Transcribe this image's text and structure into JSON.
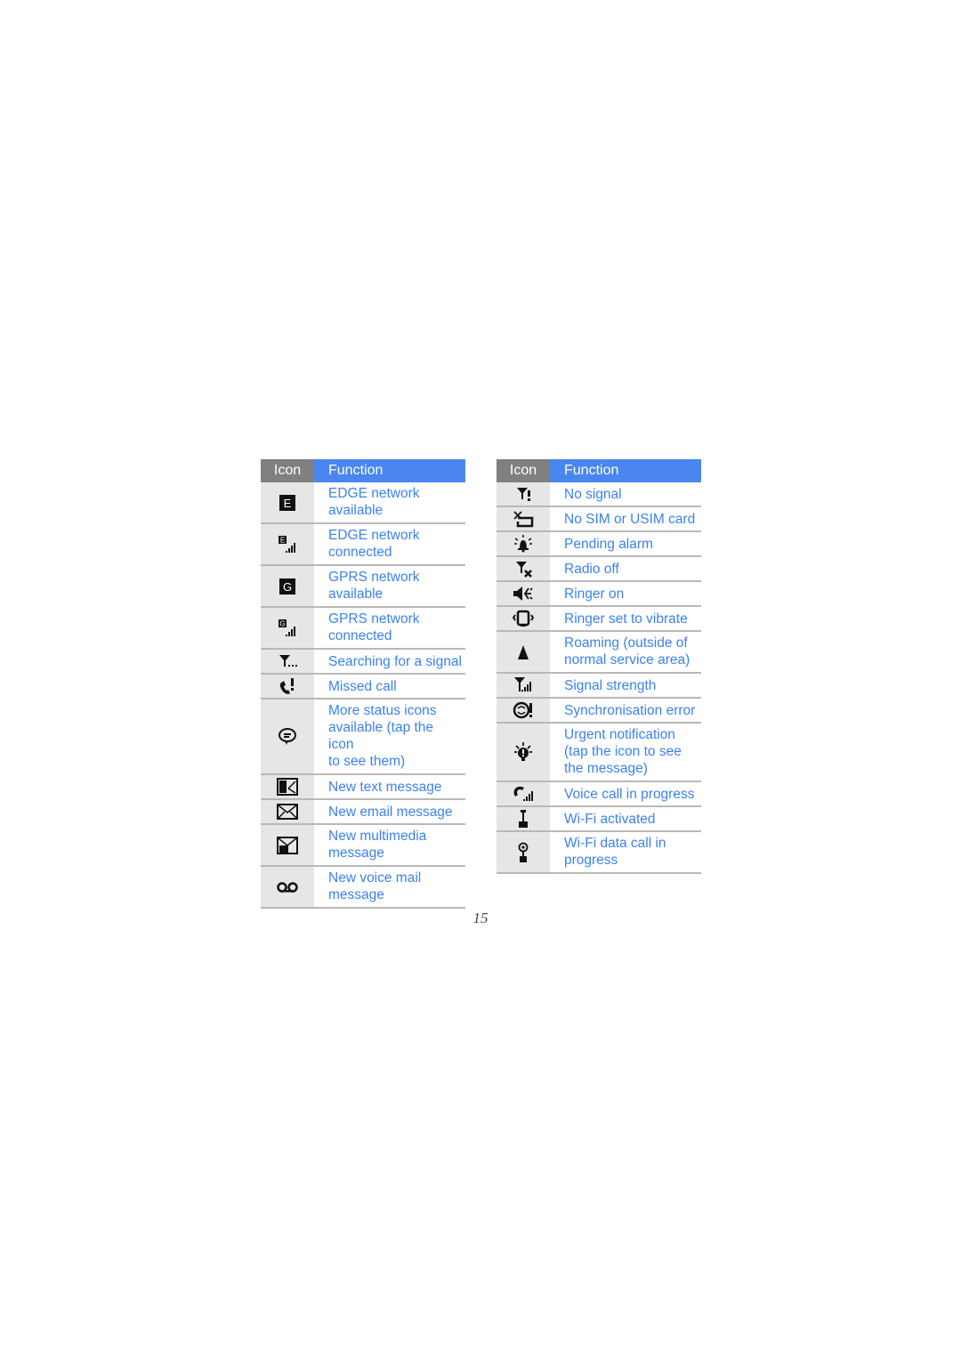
{
  "tables": [
    {
      "header": {
        "icon": "Icon",
        "function": "Function"
      },
      "rows": [
        {
          "icon": "edge-available-icon",
          "glyph": "E",
          "text": "EDGE network available",
          "lines": [
            "EDGE network",
            "available"
          ]
        },
        {
          "icon": "edge-connected-icon",
          "glyph": "E",
          "text": "EDGE network connected",
          "lines": [
            "EDGE network",
            "connected"
          ]
        },
        {
          "icon": "gprs-available-icon",
          "glyph": "G",
          "text": "GPRS network available",
          "lines": [
            "GPRS network",
            "available"
          ]
        },
        {
          "icon": "gprs-connected-icon",
          "glyph": "G",
          "text": "GPRS network connected",
          "lines": [
            "GPRS network",
            "connected"
          ]
        },
        {
          "icon": "searching-signal-icon",
          "text": "Searching for a signal",
          "lines": [
            "Searching for a signal"
          ]
        },
        {
          "icon": "missed-call-icon",
          "text": "Missed call",
          "lines": [
            "Missed call"
          ]
        },
        {
          "icon": "more-status-icon",
          "text": "More status icons available (tap the icon to see them)",
          "lines": [
            "More status icons",
            "available (tap the icon",
            "to see them)"
          ]
        },
        {
          "icon": "new-text-message-icon",
          "text": "New text message",
          "lines": [
            "New text message"
          ]
        },
        {
          "icon": "new-email-icon",
          "text": "New email message",
          "lines": [
            "New email message"
          ]
        },
        {
          "icon": "new-multimedia-message-icon",
          "text": "New multimedia message",
          "lines": [
            "New multimedia",
            "message"
          ]
        },
        {
          "icon": "voice-mail-icon",
          "text": "New voice mail message",
          "lines": [
            "New voice mail",
            "message"
          ]
        }
      ]
    },
    {
      "header": {
        "icon": "Icon",
        "function": "Function"
      },
      "rows": [
        {
          "icon": "no-signal-icon",
          "text": "No signal",
          "lines": [
            "No signal"
          ]
        },
        {
          "icon": "no-sim-icon",
          "text": "No SIM or USIM card",
          "lines": [
            "No SIM or USIM card"
          ]
        },
        {
          "icon": "pending-alarm-icon",
          "text": "Pending alarm",
          "lines": [
            "Pending alarm"
          ]
        },
        {
          "icon": "radio-off-icon",
          "text": "Radio off",
          "lines": [
            "Radio off"
          ]
        },
        {
          "icon": "ringer-on-icon",
          "text": "Ringer on",
          "lines": [
            "Ringer on"
          ]
        },
        {
          "icon": "vibrate-icon",
          "text": "Ringer set to vibrate",
          "lines": [
            "Ringer set to vibrate"
          ]
        },
        {
          "icon": "roaming-icon",
          "text": "Roaming (outside of normal service area)",
          "lines": [
            "Roaming (outside of",
            "normal service area)"
          ]
        },
        {
          "icon": "signal-strength-icon",
          "text": "Signal strength",
          "lines": [
            "Signal strength"
          ]
        },
        {
          "icon": "sync-error-icon",
          "text": "Synchronisation error",
          "lines": [
            "Synchronisation error"
          ]
        },
        {
          "icon": "urgent-notification-icon",
          "text": "Urgent notification (tap the icon to see the message)",
          "lines": [
            "Urgent notification",
            "(tap the icon to see",
            "the message)"
          ]
        },
        {
          "icon": "voice-call-icon",
          "text": "Voice call in progress",
          "lines": [
            "Voice call in progress"
          ]
        },
        {
          "icon": "wifi-activated-icon",
          "text": "Wi-Fi activated",
          "lines": [
            "Wi-Fi activated"
          ]
        },
        {
          "icon": "wifi-data-call-icon",
          "text": "Wi-Fi data call in progress",
          "lines": [
            "Wi-Fi data call in",
            "progress"
          ]
        }
      ]
    }
  ],
  "page_number": "15",
  "colors": {
    "header_icon_bg": "#808080",
    "header_function_bg": "#4a86f0",
    "text_blue": "#3b82f0",
    "icon_col_bg": "#e6e6e6"
  }
}
